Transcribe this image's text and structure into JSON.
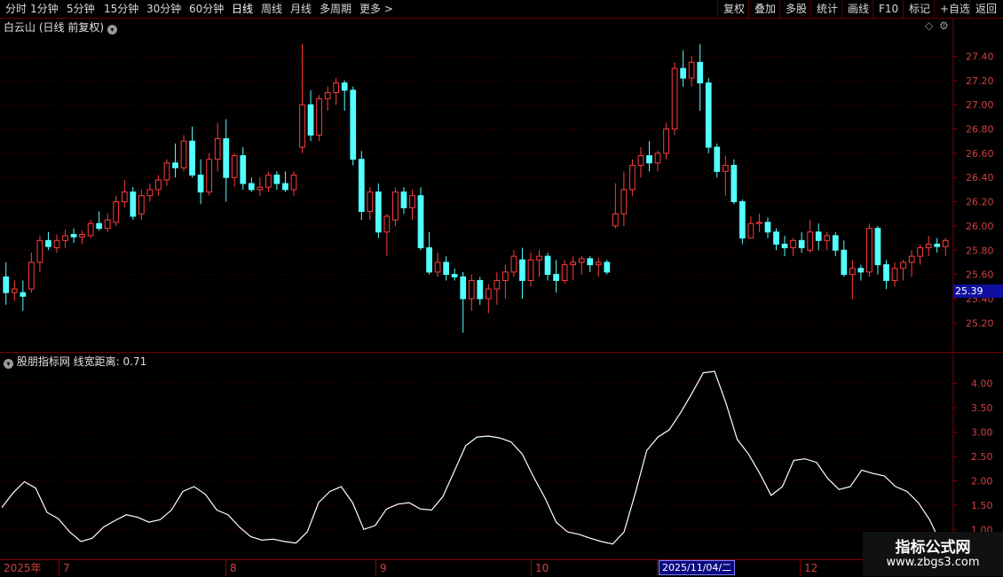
{
  "toolbar": {
    "periods": [
      "分时",
      "1分钟",
      "5分钟",
      "15分钟",
      "30分钟",
      "60分钟",
      "日线",
      "周线",
      "月线",
      "多周期",
      "更多"
    ],
    "active_period": "日线",
    "actions": [
      "复权",
      "叠加",
      "多股",
      "统计",
      "画线",
      "F10",
      "标记",
      "+自选",
      "返回"
    ]
  },
  "main_chart": {
    "stock_name": "白云山",
    "mode": "(日线 前复权)",
    "y_ticks": [
      "27.40",
      "27.20",
      "27.00",
      "26.80",
      "26.60",
      "26.40",
      "26.20",
      "26.00",
      "25.80",
      "25.60",
      "25.40",
      "25.20"
    ],
    "current_price": "25.39",
    "up_color": "#ff3c3c",
    "down_color": "#54ffff"
  },
  "indicator": {
    "name": "股朋指标网",
    "label": "线宽距离:",
    "value": "0.71",
    "y_ticks": [
      "4.00",
      "3.50",
      "3.00",
      "2.50",
      "2.00",
      "1.50",
      "1.00"
    ],
    "line_color": "#ffffff"
  },
  "date_axis": {
    "labels": [
      "2025年",
      "7",
      "8",
      "9",
      "10",
      "11",
      "12"
    ],
    "cursor_date": "2025/11/04/二"
  },
  "watermark": {
    "line1": "指标公式网",
    "line2": "www.zbgs3.com"
  },
  "chart_data": [
    {
      "type": "candlestick",
      "title": "白云山 (日线 前复权)",
      "ylim": [
        25.1,
        27.55
      ],
      "y_ticks": [
        27.4,
        27.2,
        27.0,
        26.8,
        26.6,
        26.4,
        26.2,
        26.0,
        25.8,
        25.6,
        25.4,
        25.2
      ],
      "candles_ohlc": [
        [
          25.58,
          25.7,
          25.35,
          25.45
        ],
        [
          25.45,
          25.55,
          25.38,
          25.48
        ],
        [
          25.45,
          25.55,
          25.3,
          25.42
        ],
        [
          25.48,
          25.78,
          25.45,
          25.7
        ],
        [
          25.7,
          25.92,
          25.62,
          25.88
        ],
        [
          25.88,
          25.95,
          25.8,
          25.83
        ],
        [
          25.82,
          25.93,
          25.78,
          25.88
        ],
        [
          25.88,
          25.97,
          25.82,
          25.92
        ],
        [
          25.93,
          25.98,
          25.86,
          25.91
        ],
        [
          25.91,
          25.96,
          25.85,
          25.93
        ],
        [
          25.92,
          26.05,
          25.9,
          26.02
        ],
        [
          26.02,
          26.12,
          25.96,
          25.98
        ],
        [
          25.98,
          26.1,
          25.95,
          26.05
        ],
        [
          26.03,
          26.25,
          26.0,
          26.2
        ],
        [
          26.2,
          26.38,
          26.15,
          26.28
        ],
        [
          26.28,
          26.32,
          26.05,
          26.08
        ],
        [
          26.1,
          26.3,
          26.05,
          26.25
        ],
        [
          26.25,
          26.35,
          26.2,
          26.3
        ],
        [
          26.3,
          26.42,
          26.25,
          26.38
        ],
        [
          26.38,
          26.55,
          26.33,
          26.52
        ],
        [
          26.52,
          26.68,
          26.4,
          26.48
        ],
        [
          26.48,
          26.75,
          26.45,
          26.7
        ],
        [
          26.7,
          26.82,
          26.4,
          26.42
        ],
        [
          26.42,
          26.55,
          26.18,
          26.28
        ],
        [
          26.28,
          26.6,
          26.25,
          26.55
        ],
        [
          26.55,
          26.85,
          26.45,
          26.72
        ],
        [
          26.72,
          26.88,
          26.2,
          26.4
        ],
        [
          26.4,
          26.6,
          26.32,
          26.58
        ],
        [
          26.58,
          26.65,
          26.3,
          26.35
        ],
        [
          26.35,
          26.4,
          26.28,
          26.3
        ],
        [
          26.3,
          26.4,
          26.25,
          26.32
        ],
        [
          26.32,
          26.45,
          26.28,
          26.42
        ],
        [
          26.42,
          26.45,
          26.3,
          26.35
        ],
        [
          26.35,
          26.45,
          26.28,
          26.3
        ],
        [
          26.3,
          26.45,
          26.25,
          26.42
        ],
        [
          26.65,
          27.5,
          26.6,
          27.0
        ],
        [
          27.0,
          27.12,
          26.7,
          26.75
        ],
        [
          26.75,
          27.08,
          26.7,
          27.05
        ],
        [
          27.05,
          27.15,
          26.95,
          27.1
        ],
        [
          27.1,
          27.22,
          27.0,
          27.18
        ],
        [
          27.18,
          27.2,
          26.95,
          27.12
        ],
        [
          27.12,
          27.15,
          26.5,
          26.55
        ],
        [
          26.55,
          26.62,
          26.05,
          26.12
        ],
        [
          26.12,
          26.32,
          26.05,
          26.28
        ],
        [
          26.28,
          26.35,
          25.9,
          25.95
        ],
        [
          25.95,
          26.1,
          25.75,
          26.08
        ],
        [
          26.05,
          26.32,
          26.0,
          26.28
        ],
        [
          26.28,
          26.32,
          26.1,
          26.15
        ],
        [
          26.15,
          26.3,
          26.05,
          26.25
        ],
        [
          26.25,
          26.32,
          25.8,
          25.82
        ],
        [
          25.82,
          25.95,
          25.6,
          25.62
        ],
        [
          25.62,
          25.78,
          25.58,
          25.7
        ],
        [
          25.7,
          25.75,
          25.55,
          25.6
        ],
        [
          25.6,
          25.65,
          25.55,
          25.58
        ],
        [
          25.58,
          25.62,
          25.12,
          25.4
        ],
        [
          25.4,
          25.6,
          25.3,
          25.55
        ],
        [
          25.55,
          25.58,
          25.35,
          25.4
        ],
        [
          25.4,
          25.52,
          25.28,
          25.48
        ],
        [
          25.48,
          25.62,
          25.35,
          25.55
        ],
        [
          25.55,
          25.68,
          25.4,
          25.62
        ],
        [
          25.62,
          25.8,
          25.58,
          25.75
        ],
        [
          25.72,
          25.82,
          25.4,
          25.55
        ],
        [
          25.55,
          25.78,
          25.5,
          25.72
        ],
        [
          25.72,
          25.8,
          25.58,
          25.75
        ],
        [
          25.75,
          25.78,
          25.55,
          25.6
        ],
        [
          25.6,
          25.72,
          25.45,
          25.55
        ],
        [
          25.55,
          25.72,
          25.52,
          25.68
        ],
        [
          25.68,
          25.75,
          25.55,
          25.7
        ],
        [
          25.7,
          25.75,
          25.6,
          25.73
        ],
        [
          25.73,
          25.75,
          25.62,
          25.68
        ],
        [
          25.68,
          25.74,
          25.58,
          25.7
        ],
        [
          25.7,
          25.72,
          25.6,
          25.62
        ],
        [
          26.0,
          26.35,
          25.98,
          26.1
        ],
        [
          26.1,
          26.45,
          26.0,
          26.3
        ],
        [
          26.3,
          26.55,
          26.25,
          26.5
        ],
        [
          26.5,
          26.65,
          26.4,
          26.58
        ],
        [
          26.58,
          26.7,
          26.45,
          26.52
        ],
        [
          26.52,
          26.62,
          26.45,
          26.6
        ],
        [
          26.6,
          26.85,
          26.55,
          26.8
        ],
        [
          26.8,
          27.35,
          26.75,
          27.3
        ],
        [
          27.3,
          27.45,
          27.15,
          27.22
        ],
        [
          27.22,
          27.4,
          27.15,
          27.35
        ],
        [
          27.35,
          27.5,
          26.95,
          27.18
        ],
        [
          27.18,
          27.22,
          26.6,
          26.65
        ],
        [
          26.65,
          26.68,
          26.4,
          26.45
        ],
        [
          26.45,
          26.58,
          26.25,
          26.5
        ],
        [
          26.5,
          26.55,
          26.18,
          26.2
        ],
        [
          26.2,
          26.22,
          25.85,
          25.9
        ],
        [
          25.9,
          26.08,
          25.95,
          26.02
        ],
        [
          26.02,
          26.1,
          25.95,
          26.03
        ],
        [
          26.03,
          26.07,
          25.9,
          25.95
        ],
        [
          25.95,
          25.98,
          25.8,
          25.85
        ],
        [
          25.85,
          25.92,
          25.75,
          25.82
        ],
        [
          25.82,
          25.9,
          25.75,
          25.88
        ],
        [
          25.88,
          25.95,
          25.78,
          25.82
        ],
        [
          25.8,
          26.05,
          25.78,
          25.95
        ],
        [
          25.95,
          26.02,
          25.8,
          25.88
        ],
        [
          25.88,
          25.95,
          25.8,
          25.92
        ],
        [
          25.92,
          25.95,
          25.75,
          25.8
        ],
        [
          25.8,
          25.88,
          25.58,
          25.6
        ],
        [
          25.6,
          25.72,
          25.4,
          25.65
        ],
        [
          25.65,
          25.68,
          25.55,
          25.62
        ],
        [
          25.62,
          26.02,
          25.58,
          25.98
        ],
        [
          25.98,
          26.0,
          25.6,
          25.68
        ],
        [
          25.68,
          25.72,
          25.48,
          25.55
        ],
        [
          25.55,
          25.7,
          25.5,
          25.65
        ],
        [
          25.65,
          25.72,
          25.55,
          25.7
        ],
        [
          25.7,
          25.8,
          25.58,
          25.75
        ],
        [
          25.75,
          25.85,
          25.68,
          25.82
        ],
        [
          25.82,
          25.92,
          25.75,
          25.85
        ],
        [
          25.85,
          25.9,
          25.78,
          25.83
        ],
        [
          25.83,
          25.9,
          25.75,
          25.88
        ]
      ]
    },
    {
      "type": "line",
      "title": "股朋指标网 线宽距离: 0.71",
      "ylim": [
        0.55,
        4.45
      ],
      "y_ticks": [
        4.0,
        3.5,
        3.0,
        2.5,
        2.0,
        1.5,
        1.0
      ],
      "values": [
        1.45,
        1.75,
        1.98,
        1.85,
        1.35,
        1.22,
        0.95,
        0.75,
        0.82,
        1.05,
        1.18,
        1.3,
        1.25,
        1.15,
        1.2,
        1.4,
        1.78,
        1.88,
        1.72,
        1.4,
        1.3,
        1.05,
        0.85,
        0.78,
        0.8,
        0.75,
        0.72,
        0.95,
        1.55,
        1.78,
        1.88,
        1.55,
        1.0,
        1.08,
        1.42,
        1.52,
        1.55,
        1.42,
        1.4,
        1.68,
        2.2,
        2.72,
        2.9,
        2.92,
        2.88,
        2.8,
        2.55,
        2.08,
        1.65,
        1.15,
        0.95,
        0.9,
        0.82,
        0.75,
        0.7,
        0.95,
        1.75,
        2.62,
        2.9,
        3.05,
        3.4,
        3.8,
        4.22,
        4.25,
        3.6,
        2.85,
        2.55,
        2.15,
        1.7,
        1.88,
        2.42,
        2.45,
        2.38,
        2.05,
        1.82,
        1.88,
        2.22,
        2.15,
        2.1,
        1.88,
        1.78,
        1.55,
        1.2,
        0.71
      ]
    }
  ]
}
